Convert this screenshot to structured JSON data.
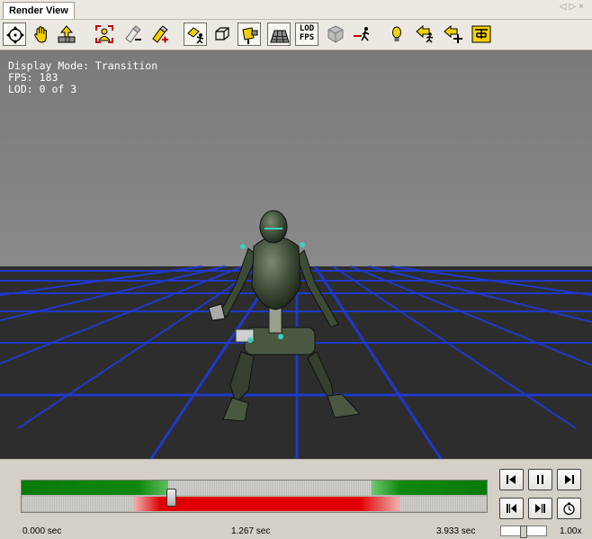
{
  "tab": {
    "title": "Render View"
  },
  "toolbar": {
    "buttons": [
      {
        "name": "orbit-camera-tool",
        "icon": "orbit-icon",
        "active": true
      },
      {
        "name": "pan-hand-tool",
        "icon": "hand-icon",
        "active": false
      },
      {
        "name": "zoom-tool",
        "icon": "zoom-arrow-icon",
        "active": false
      },
      {
        "name": "frame-all-tool",
        "icon": "frame-all-icon",
        "active": false
      },
      {
        "name": "remove-light-tool",
        "icon": "remove-light-icon",
        "active": false
      },
      {
        "name": "add-light-tool",
        "icon": "add-light-icon",
        "active": false
      },
      {
        "name": "bone-select-tool",
        "icon": "bone-select-icon",
        "active": true
      },
      {
        "name": "wireframe-box-tool",
        "icon": "wireframe-box-icon",
        "active": false
      },
      {
        "name": "spotlight-tool",
        "icon": "spotlight-icon",
        "active": true
      },
      {
        "name": "ground-grid-tool",
        "icon": "grid-icon",
        "active": true
      },
      {
        "name": "lod-fps-tool",
        "icon": "lod-fps-icon",
        "active": true,
        "label_top": "LOD",
        "label_bottom": "FPS"
      },
      {
        "name": "bounding-box-tool",
        "icon": "cube-icon",
        "active": false
      },
      {
        "name": "root-motion-tool",
        "icon": "root-motion-icon",
        "active": false
      },
      {
        "name": "light-bulb-tool",
        "icon": "light-bulb-icon",
        "active": false
      },
      {
        "name": "walk-back-tool",
        "icon": "walk-back-icon",
        "active": false
      },
      {
        "name": "add-point-tool",
        "icon": "add-point-icon",
        "active": false
      },
      {
        "name": "skeleton-tool",
        "icon": "skeleton-icon",
        "active": false
      }
    ]
  },
  "hud": {
    "display_mode": "Display Mode: Transition",
    "fps": "FPS: 183",
    "lod": "LOD: 0 of 3"
  },
  "timeline": {
    "start_label": "0.000 sec",
    "current_label": "1.267 sec",
    "end_label": "3.933 sec",
    "position_fraction": 0.322
  },
  "playback": {
    "speed_label": "1.00x",
    "buttons": [
      "go-to-start",
      "pause",
      "go-to-end",
      "step-back",
      "step-forward",
      "timer"
    ]
  },
  "colors": {
    "viewport_background": "#808080",
    "floor": "#2d2d2d",
    "grid_lines": "#1f39c8",
    "track_green": "#0f880f",
    "track_red": "#e00000"
  }
}
